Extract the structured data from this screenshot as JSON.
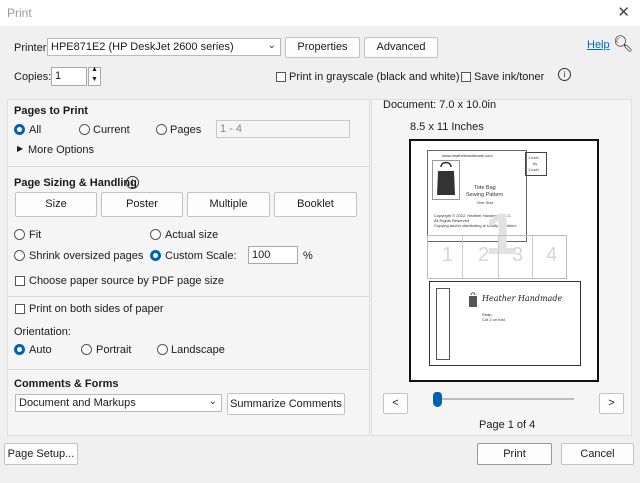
{
  "window": {
    "title": "Print"
  },
  "printer": {
    "label": "Printer:",
    "selected": "HPE871E2 (HP DeskJet 2600 series)",
    "properties_label": "Properties",
    "advanced_label": "Advanced",
    "help_label": "Help"
  },
  "copies": {
    "label": "Copies:",
    "value": "1",
    "grayscale_label": "Print in grayscale (black and white)",
    "save_ink_label": "Save ink/toner"
  },
  "pages_to_print": {
    "heading": "Pages to Print",
    "all_label": "All",
    "current_label": "Current",
    "pages_label": "Pages",
    "pages_range_value": "1 - 4",
    "more_options_label": "More Options"
  },
  "sizing": {
    "heading": "Page Sizing & Handling",
    "tabs": [
      "Size",
      "Poster",
      "Multiple",
      "Booklet"
    ],
    "fit_label": "Fit",
    "actual_size_label": "Actual size",
    "shrink_label": "Shrink oversized pages",
    "custom_scale_label": "Custom Scale:",
    "custom_scale_value": "100",
    "percent_label": "%",
    "paper_source_label": "Choose paper source by PDF page size"
  },
  "duplex": {
    "both_sides_label": "Print on both sides of paper",
    "orientation_label": "Orientation:",
    "auto_label": "Auto",
    "portrait_label": "Portrait",
    "landscape_label": "Landscape"
  },
  "comments": {
    "heading": "Comments & Forms",
    "selected": "Document and Markups",
    "summarize_label": "Summarize Comments"
  },
  "preview": {
    "document_size": "Document: 7.0 x 10.0in",
    "paper_size": "8.5 x 11 Inches",
    "page_indicator": "Page 1 of 4",
    "prev_label": "<",
    "next_label": ">",
    "slider_position": 0
  },
  "preview_content": {
    "site": "www.heatherhandmade.com",
    "pattern_title_line1": "Tote Bag",
    "pattern_title_line2": "Sewing Pattern",
    "pattern_subtitle": "One Size",
    "copyright_line1": "Copyright © 2022, Heather Handmade LLC",
    "copyright_line2": "All Rights Reserved",
    "copyright_line3": "Copying and/or distributing is strictly forbidden.",
    "scale_line1": "1 inch",
    "scale_line2": "by",
    "scale_line3": "1 inch",
    "watermark": "1",
    "cells": [
      "1",
      "2",
      "3",
      "4"
    ],
    "brand_name": "Heather Handmade",
    "brand_logo_alt": "Heather Handmade",
    "strap_label": "Strap",
    "cut_label": "Cut 2 on fold"
  },
  "footer": {
    "page_setup_label": "Page Setup...",
    "print_label": "Print",
    "cancel_label": "Cancel"
  },
  "colors": {
    "accent": "#0063b1",
    "link": "#0066cc"
  }
}
